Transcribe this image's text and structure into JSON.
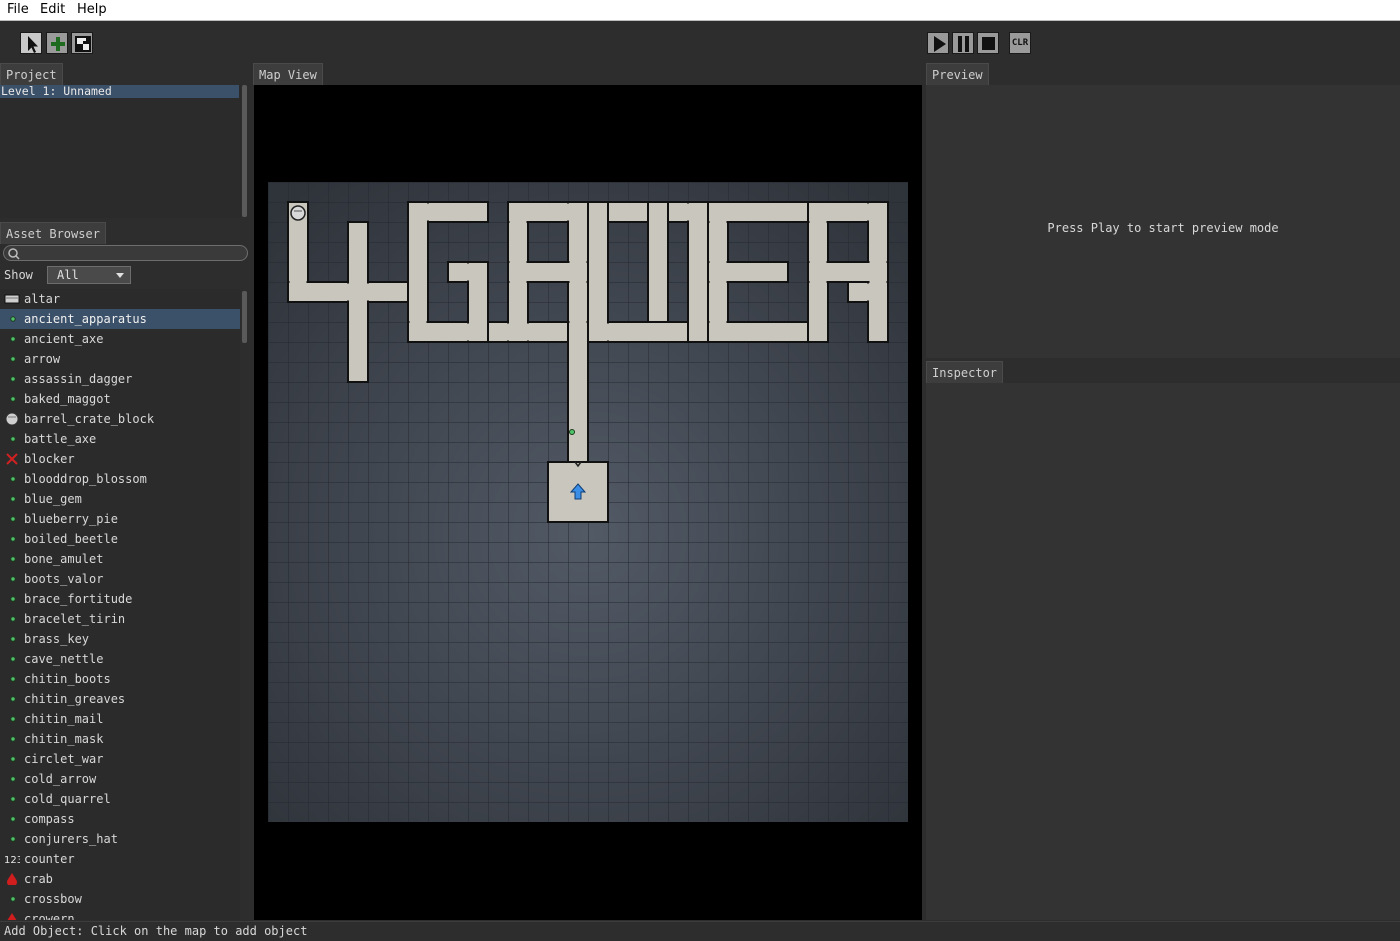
{
  "menu": {
    "file": "File",
    "edit": "Edit",
    "help": "Help"
  },
  "toolbar": {
    "left_tools": [
      "select-tool",
      "add-object-tool",
      "paint-tool"
    ],
    "clear_label": "CLR"
  },
  "panels": {
    "project_tab": "Project",
    "asset_browser_tab": "Asset Browser",
    "map_view_tab": "Map View",
    "preview_tab": "Preview",
    "inspector_tab": "Inspector"
  },
  "project": {
    "items": [
      "Level 1: Unnamed"
    ]
  },
  "asset_browser": {
    "search_placeholder": "",
    "show_label": "Show",
    "show_value": "All",
    "selected": "ancient_apparatus",
    "items": [
      {
        "label": "altar",
        "icon": "altar-icon"
      },
      {
        "label": "ancient_apparatus",
        "icon": "item-dot-icon"
      },
      {
        "label": "ancient_axe",
        "icon": "item-dot-icon"
      },
      {
        "label": "arrow",
        "icon": "item-dot-icon"
      },
      {
        "label": "assassin_dagger",
        "icon": "item-dot-icon"
      },
      {
        "label": "baked_maggot",
        "icon": "item-dot-icon"
      },
      {
        "label": "barrel_crate_block",
        "icon": "barrel-icon"
      },
      {
        "label": "battle_axe",
        "icon": "item-dot-icon"
      },
      {
        "label": "blocker",
        "icon": "blocker-x-icon"
      },
      {
        "label": "blooddrop_blossom",
        "icon": "item-dot-icon"
      },
      {
        "label": "blue_gem",
        "icon": "item-dot-icon"
      },
      {
        "label": "blueberry_pie",
        "icon": "item-dot-icon"
      },
      {
        "label": "boiled_beetle",
        "icon": "item-dot-icon"
      },
      {
        "label": "bone_amulet",
        "icon": "item-dot-icon"
      },
      {
        "label": "boots_valor",
        "icon": "item-dot-icon"
      },
      {
        "label": "brace_fortitude",
        "icon": "item-dot-icon"
      },
      {
        "label": "bracelet_tirin",
        "icon": "item-dot-icon"
      },
      {
        "label": "brass_key",
        "icon": "item-dot-icon"
      },
      {
        "label": "cave_nettle",
        "icon": "item-dot-icon"
      },
      {
        "label": "chitin_boots",
        "icon": "item-dot-icon"
      },
      {
        "label": "chitin_greaves",
        "icon": "item-dot-icon"
      },
      {
        "label": "chitin_mail",
        "icon": "item-dot-icon"
      },
      {
        "label": "chitin_mask",
        "icon": "item-dot-icon"
      },
      {
        "label": "circlet_war",
        "icon": "item-dot-icon"
      },
      {
        "label": "cold_arrow",
        "icon": "item-dot-icon"
      },
      {
        "label": "cold_quarrel",
        "icon": "item-dot-icon"
      },
      {
        "label": "compass",
        "icon": "item-dot-icon"
      },
      {
        "label": "conjurers_hat",
        "icon": "item-dot-icon"
      },
      {
        "label": "counter",
        "icon": "counter-123-icon"
      },
      {
        "label": "crab",
        "icon": "monster-drop-icon"
      },
      {
        "label": "crossbow",
        "icon": "item-dot-icon"
      },
      {
        "label": "crowern",
        "icon": "monster-drop-icon"
      }
    ]
  },
  "preview": {
    "message": "Press Play to start preview mode"
  },
  "status": {
    "text": "Add Object: Click on the map to add object"
  },
  "colors": {
    "background": "#2d2d2d",
    "selection": "#3b5069",
    "floor": "#c9c7bd",
    "grid_bg": "#3c4149",
    "item_dot": "#4fc36b",
    "blocker": "#d02020",
    "party_arrow": "#3a8ee6"
  }
}
